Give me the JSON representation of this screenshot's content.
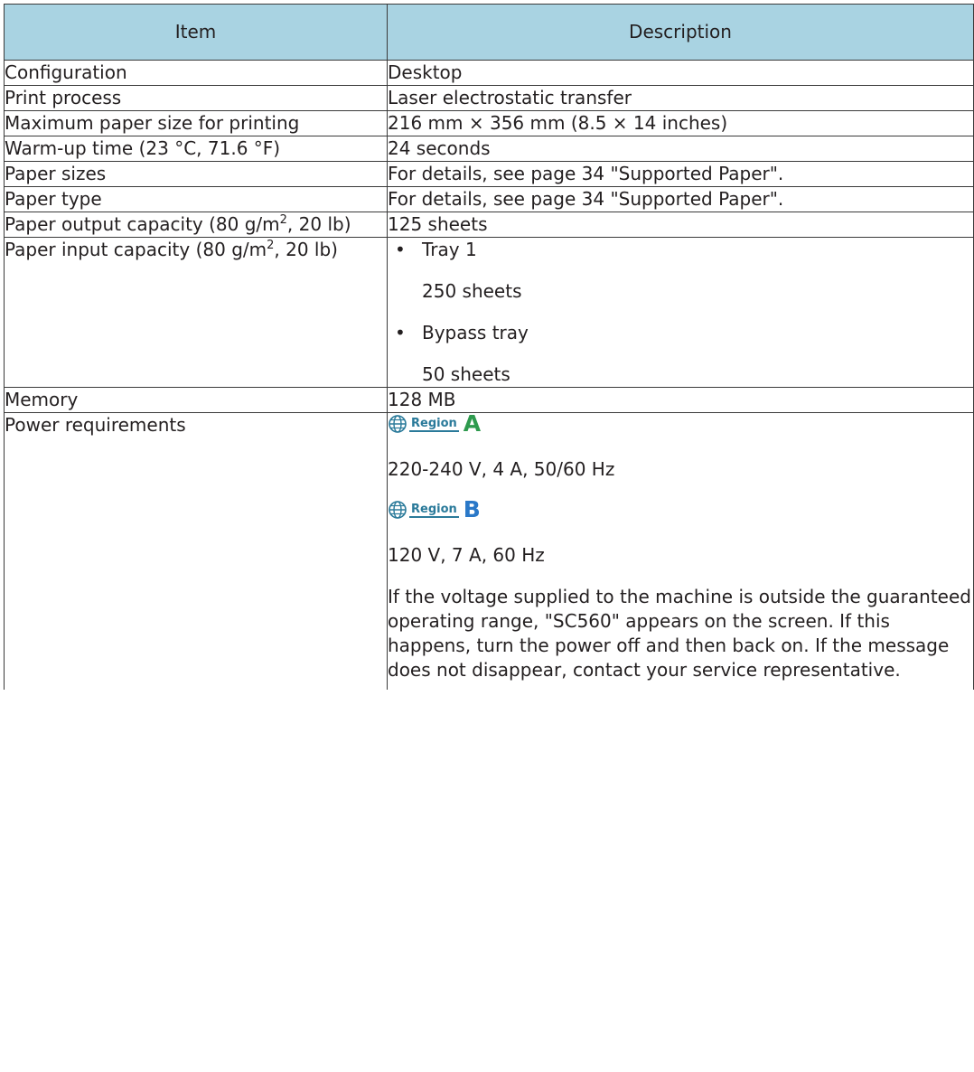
{
  "header": {
    "item": "Item",
    "description": "Description"
  },
  "rows": {
    "configuration": {
      "item": "Configuration",
      "desc": "Desktop"
    },
    "print_process": {
      "item": "Print process",
      "desc": "Laser electrostatic transfer"
    },
    "max_paper": {
      "item": "Maximum paper size for printing",
      "desc": "216 mm × 356 mm (8.5 × 14 inches)"
    },
    "warmup": {
      "item": "Warm-up time (23 °C, 71.6 °F)",
      "desc": "24 seconds"
    },
    "paper_sizes": {
      "item": "Paper sizes",
      "desc": "For details, see page 34 \"Supported Paper\"."
    },
    "paper_type": {
      "item": "Paper type",
      "desc": "For details, see page 34 \"Supported Paper\"."
    },
    "output_capacity": {
      "item_before": "Paper output capacity (80 g/m",
      "item_sup": "2",
      "item_after": ", 20 lb)",
      "desc": "125 sheets"
    },
    "input_capacity": {
      "item_before": "Paper input capacity (80 g/m",
      "item_sup": "2",
      "item_after": ", 20 lb)",
      "trays": [
        {
          "name": "Tray 1",
          "value": "250 sheets"
        },
        {
          "name": "Bypass tray",
          "value": "50 sheets"
        }
      ]
    },
    "memory": {
      "item": "Memory",
      "desc": "128 MB"
    },
    "power": {
      "item": "Power requirements",
      "region_word": "Region",
      "region_a": {
        "letter": "A",
        "color": "#2e9a4e",
        "value": "220-240 V, 4 A, 50/60 Hz"
      },
      "region_b": {
        "letter": "B",
        "color": "#2a78c8",
        "value": "120 V, 7 A, 60 Hz"
      },
      "note": "If the voltage supplied to the machine is outside the guaranteed operating range, \"SC560\" appears on the screen. If this happens, turn the power off and then back on. If the message does not disappear, contact your service representative."
    }
  },
  "colors": {
    "header_bg": "#a9d3e2",
    "border": "#3a3a3a",
    "text": "#231f20",
    "region_label": "#2a7a9a"
  },
  "icons": {
    "globe": "globe-icon"
  }
}
